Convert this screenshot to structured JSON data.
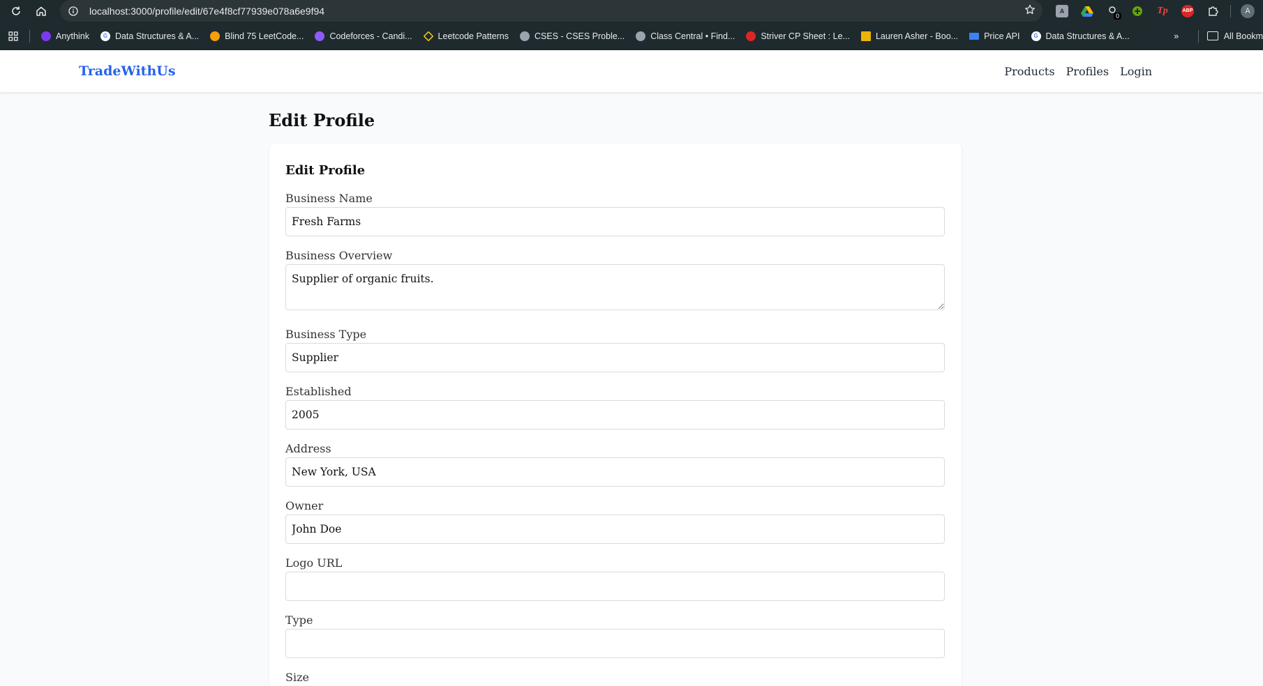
{
  "browser": {
    "url": "localhost:3000/profile/edit/67e4f8cf77939e078a6e9f94",
    "bookmarks": [
      {
        "label": "Anythink",
        "icon": "anythink-icon",
        "color": "#7c3aed"
      },
      {
        "label": "Data Structures & A...",
        "icon": "google-icon",
        "color": "#ffffff"
      },
      {
        "label": "Blind 75 LeetCode...",
        "icon": "leetcode-icon",
        "color": "#f59e0b"
      },
      {
        "label": "Codeforces - Candi...",
        "icon": "codeforces-icon",
        "color": "#8b5cf6"
      },
      {
        "label": "Leetcode Patterns",
        "icon": "diamond-icon",
        "color": "#facc15"
      },
      {
        "label": "CSES - CSES Proble...",
        "icon": "globe-icon",
        "color": "#9ca3af"
      },
      {
        "label": "Class Central • Find...",
        "icon": "globe-icon",
        "color": "#9ca3af"
      },
      {
        "label": "Striver CP Sheet : Le...",
        "icon": "tuf-icon",
        "color": "#dc2626"
      },
      {
        "label": "Lauren Asher - Boo...",
        "icon": "books-icon",
        "color": "#eab308"
      },
      {
        "label": "Price API",
        "icon": "flag-icon",
        "color": "#3b82f6"
      },
      {
        "label": "Data Structures & A...",
        "icon": "google-icon",
        "color": "#ffffff"
      }
    ],
    "all_bookmarks": "All Bookm",
    "profile_initial": "A",
    "ext_badge": "0"
  },
  "header": {
    "brand": "TradeWithUs",
    "nav": [
      "Products",
      "Profiles",
      "Login"
    ]
  },
  "page": {
    "title": "Edit Profile",
    "card_title": "Edit Profile",
    "fields": [
      {
        "label": "Business Name",
        "value": "Fresh Farms"
      },
      {
        "label": "Business Overview",
        "value": "Supplier of organic fruits."
      },
      {
        "label": "Business Type",
        "value": "Supplier"
      },
      {
        "label": "Established",
        "value": "2005"
      },
      {
        "label": "Address",
        "value": "New York, USA"
      },
      {
        "label": "Owner",
        "value": "John Doe"
      },
      {
        "label": "Logo URL",
        "value": ""
      },
      {
        "label": "Type",
        "value": ""
      },
      {
        "label": "Size",
        "value": ""
      }
    ]
  },
  "colors": {
    "brand": "#2563eb",
    "chrome": "#1f2a2e",
    "page_bg": "#f8fafc"
  }
}
